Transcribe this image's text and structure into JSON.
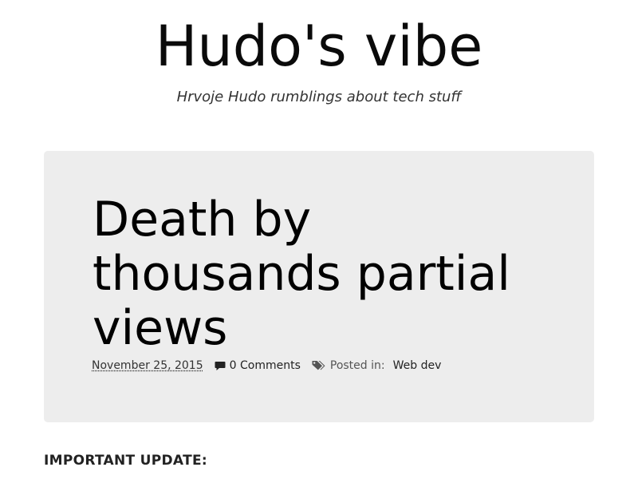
{
  "site": {
    "title": "Hudo's vibe",
    "tagline": "Hrvoje Hudo rumblings about tech stuff"
  },
  "post": {
    "title": "Death by thousands partial views",
    "date": "November 25, 2015",
    "comments": "0 Comments",
    "posted_in_label": "Posted in:",
    "category": "Web dev"
  },
  "content": {
    "first_heading": "IMPORTANT UPDATE:"
  },
  "icons": {
    "comments": "comment-icon",
    "tags": "tags-icon"
  },
  "colors": {
    "hero_background": "#ededed",
    "text": "#111111"
  }
}
